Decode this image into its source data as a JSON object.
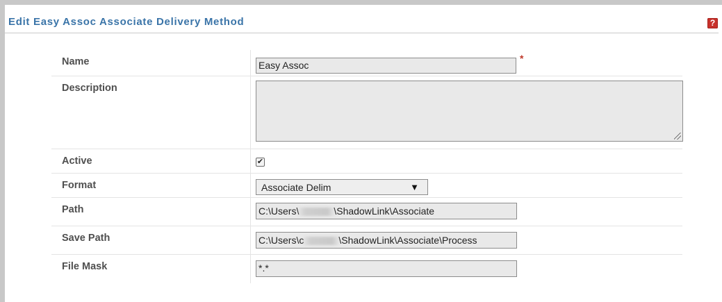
{
  "header": {
    "title": "Edit Easy Assoc Associate Delivery Method",
    "help_icon_text": "?"
  },
  "form": {
    "name": {
      "label": "Name",
      "value": "Easy Assoc",
      "required_marker": "*"
    },
    "description": {
      "label": "Description",
      "value": ""
    },
    "active": {
      "label": "Active",
      "checked": true,
      "check_glyph": "✔"
    },
    "format": {
      "label": "Format",
      "selected": "Associate Delim",
      "caret": "▼"
    },
    "path": {
      "label": "Path",
      "value_prefix": "C:\\Users\\",
      "value_suffix": "\\ShadowLink\\Associate"
    },
    "save_path": {
      "label": "Save Path",
      "value_prefix": "C:\\Users\\c",
      "value_suffix": "\\ShadowLink\\Associate\\Process"
    },
    "file_mask": {
      "label": "File Mask",
      "value": "*.*"
    }
  },
  "colors": {
    "title": "#3a74a8",
    "help_icon": "#c8312b",
    "required": "#c0392b",
    "field_bg": "#e9e9e9"
  }
}
